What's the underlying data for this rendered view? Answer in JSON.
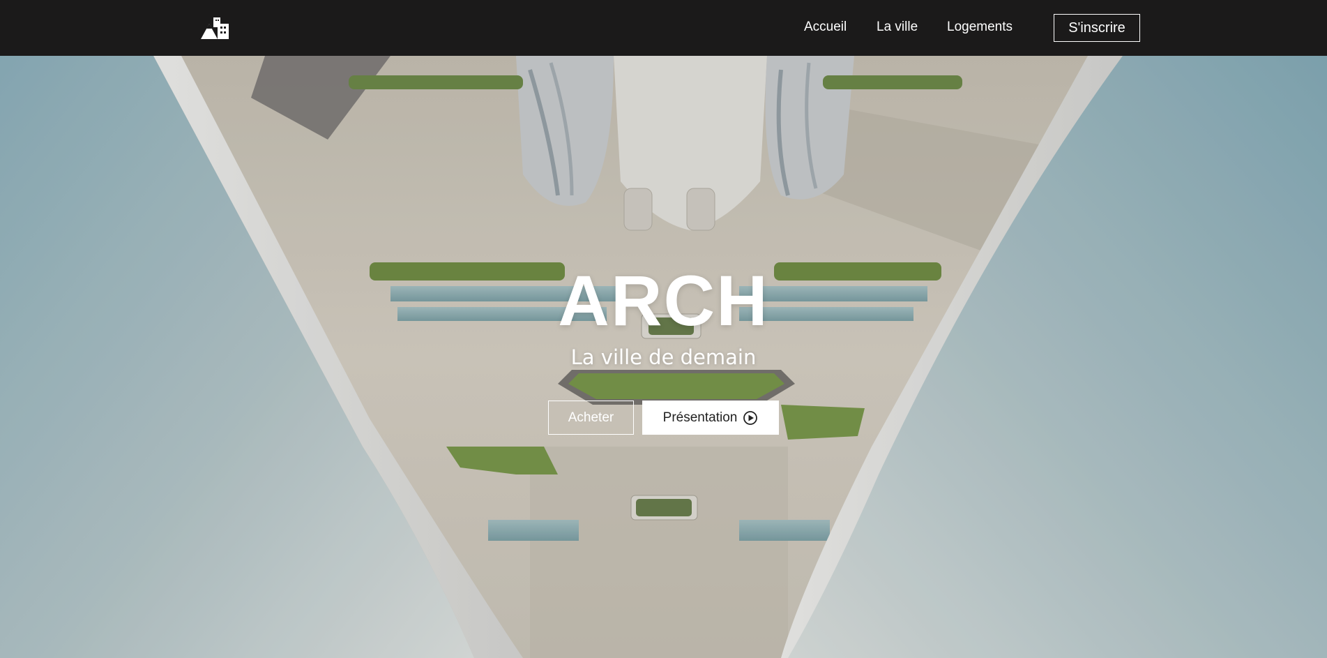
{
  "nav": {
    "logo_icon": "mountain-building-logo-icon",
    "links": [
      {
        "label": "Accueil"
      },
      {
        "label": "La ville"
      },
      {
        "label": "Logements"
      }
    ],
    "signup_label": "S'inscrire"
  },
  "hero": {
    "title": "ARCH",
    "subtitle": "La ville de demain",
    "buy_label": "Acheter",
    "presentation_label": "Présentation",
    "presentation_icon": "play-circle-icon"
  },
  "colors": {
    "navbar_bg": "#1b1a1a",
    "text_light": "#ffffff",
    "sky_blue": "#8fb4c0",
    "plaza": "#d8d2c6"
  }
}
